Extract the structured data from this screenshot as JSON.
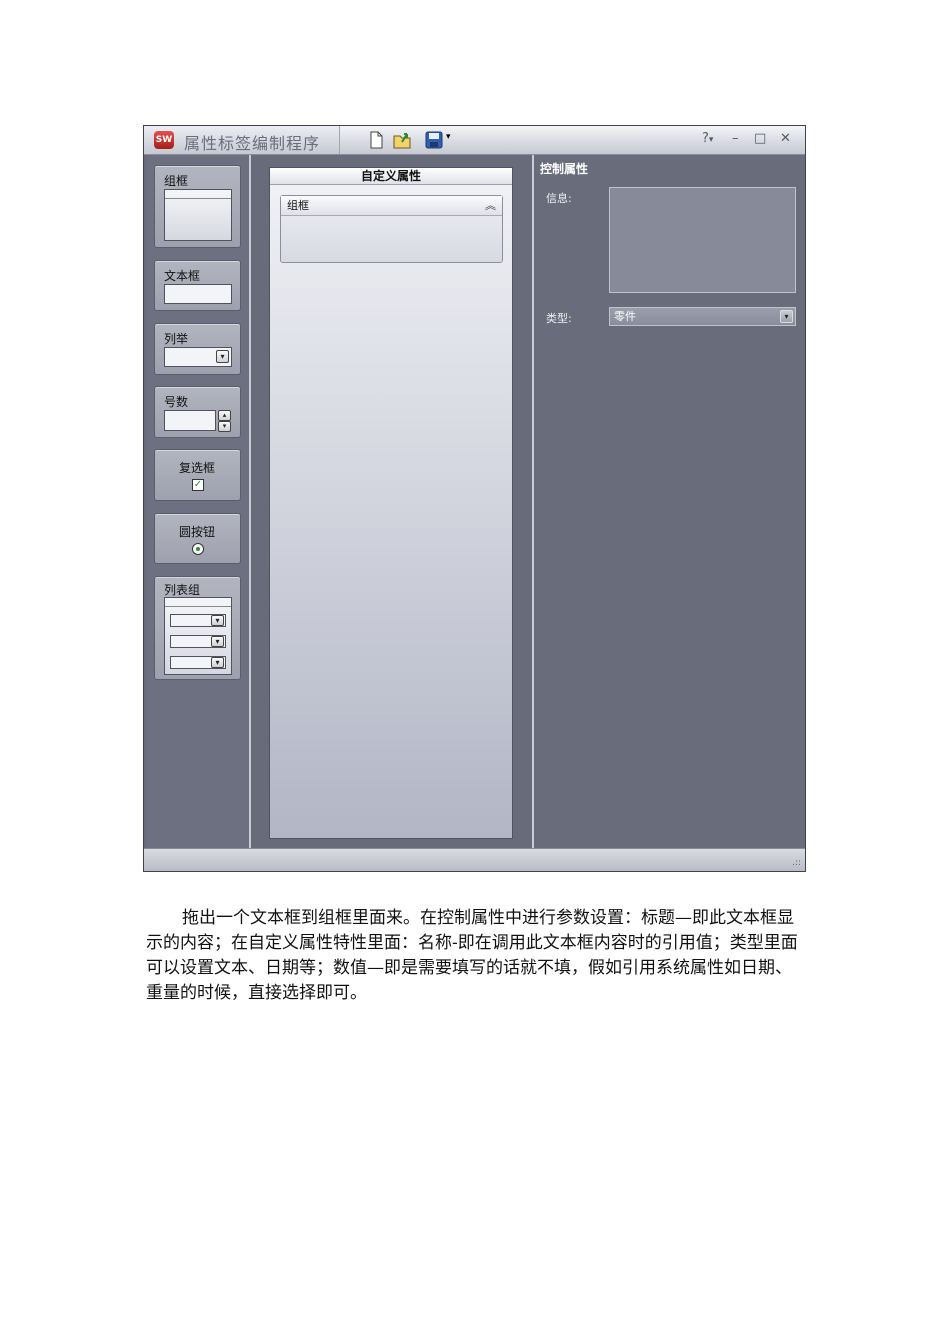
{
  "window": {
    "title": "属性标签编制程序",
    "logo_text": "SW",
    "help": "?",
    "minimize": "–",
    "maximize": "□",
    "close": "✕"
  },
  "toolbox": {
    "items": [
      {
        "label": "组框"
      },
      {
        "label": "文本框"
      },
      {
        "label": "列举"
      },
      {
        "label": "号数"
      },
      {
        "label": "复选框"
      },
      {
        "label": "圆按钮"
      },
      {
        "label": "列表组"
      }
    ]
  },
  "custom_properties": {
    "header": "自定义属性",
    "groupbox_title": "组框"
  },
  "control_properties": {
    "title": "控制属性",
    "info_label": "信息:",
    "type_label": "类型:",
    "type_value": "零件"
  },
  "body_paragraph": "拖出一个文本框到组框里面来。在控制属性中进行参数设置：标题—即此文本框显示的内容；在自定义属性特性里面：名称-即在调用此文本框内容时的引用值；类型里面可以设置文本、日期等；数值—即是需要填写的话就不填，假如引用系统属性如日期、重量的时候，直接选择即可。",
  "colors": {
    "window_bg": "#676b7a",
    "titlebar": "#d9dbe2",
    "logo_red": "#c0312b"
  }
}
